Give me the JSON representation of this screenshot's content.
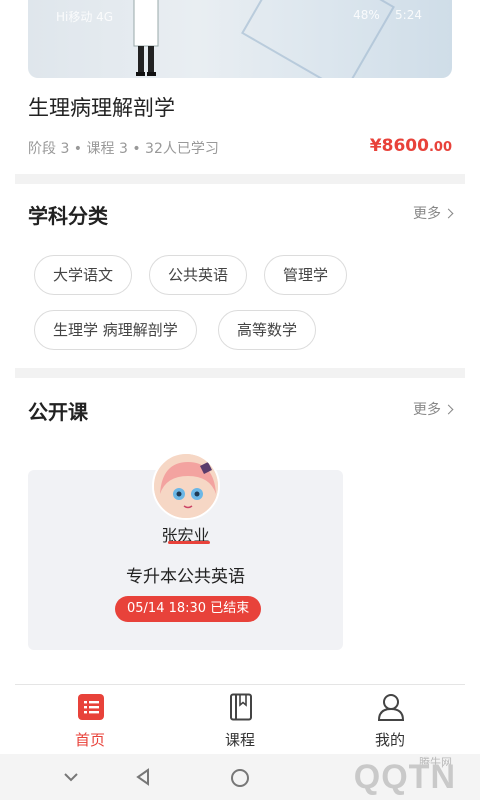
{
  "status_bar": {
    "carrier": "Hi移动 4G",
    "battery": "48%",
    "time": "5:24"
  },
  "featured_course": {
    "title": "生理病理解剖学",
    "meta": "阶段 3 • 课程 3 • 32人已学习",
    "price_currency": "¥",
    "price_int": "8600",
    "price_dec": ".00"
  },
  "subjects": {
    "title": "学科分类",
    "more_label": "更多",
    "tags": [
      "大学语文",
      "公共英语",
      "管理学",
      "生理学 病理解剖学",
      "高等数学"
    ]
  },
  "open_courses": {
    "title": "公开课",
    "more_label": "更多",
    "card": {
      "teacher": "张宏业",
      "course_name": "专升本公共英语",
      "status": "05/14 18:30  已结束"
    }
  },
  "bottom_nav": {
    "items": [
      {
        "label": "首页",
        "icon": "home-list-icon",
        "active": true
      },
      {
        "label": "课程",
        "icon": "book-icon",
        "active": false
      },
      {
        "label": "我的",
        "icon": "user-icon",
        "active": false
      }
    ]
  },
  "watermark": {
    "text": "QQTN",
    "sub": "腾牛网"
  },
  "colors": {
    "accent": "#e8423a",
    "divider": "#f2f2f2",
    "card_bg": "#f1f2f5"
  }
}
